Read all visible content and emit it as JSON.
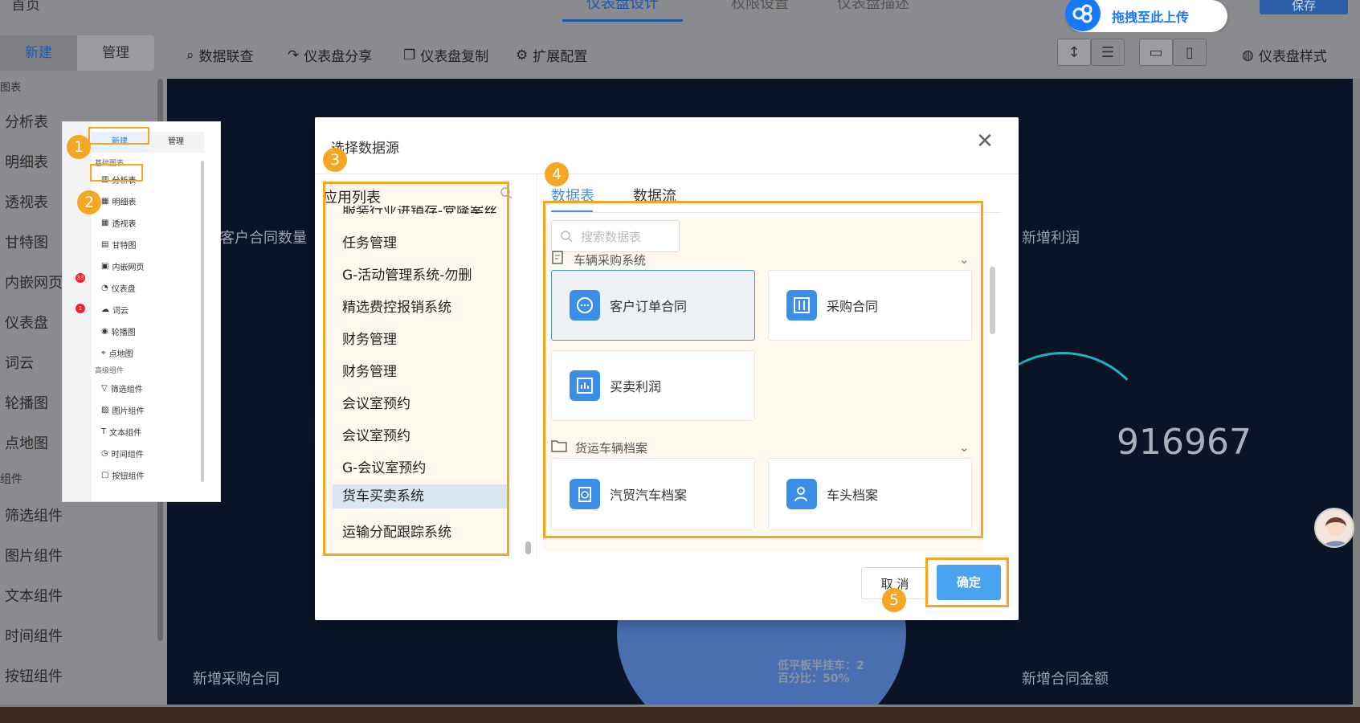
{
  "topbar": {
    "left_title": "首页",
    "tabs": [
      "仪表盘设计",
      "权限设置",
      "仪表盘描述"
    ],
    "upload_label": "拖拽至此上传",
    "save_label": "保存"
  },
  "sidebar": {
    "tabs": [
      "新建",
      "管理"
    ],
    "section_basic": "图表",
    "items_basic": [
      "分析表",
      "明细表",
      "透视表",
      "甘特图",
      "内嵌网页",
      "仪表盘",
      "词云",
      "轮播图",
      "点地图"
    ],
    "section_advanced": "组件",
    "items_advanced": [
      "筛选组件",
      "图片组件",
      "文本组件",
      "时间组件",
      "按钮组件"
    ]
  },
  "toolbar": {
    "items": [
      "数据联查",
      "仪表盘分享",
      "仪表盘复制",
      "扩展配置"
    ],
    "style_label": "仪表盘样式"
  },
  "canvas": {
    "labels": [
      "客户合同数量",
      "新增利润",
      "新增采购合同",
      "新增合同金额"
    ],
    "big_number": "916967",
    "annot_line1": "低平板半挂车：2",
    "annot_line2": "百分比：50%"
  },
  "inset": {
    "tabs": [
      "新建",
      "管理"
    ],
    "section_basic": "基础图表",
    "items_basic": [
      "分析表",
      "明细表",
      "透视表",
      "甘特图",
      "内嵌网页",
      "仪表盘",
      "词云",
      "轮播图",
      "点地图"
    ],
    "section_advanced": "高级组件",
    "items_advanced": [
      "筛选组件",
      "图片组件",
      "文本组件",
      "时间组件",
      "按钮组件"
    ],
    "badges": [
      "33",
      "1"
    ]
  },
  "steps": [
    "1",
    "2",
    "3",
    "4",
    "5"
  ],
  "modal": {
    "title": "选择数据源",
    "app_list_title": "应用列表",
    "apps": [
      "服装行业进销存-党隆案丝",
      "任务管理",
      "G-活动管理系统-勿删",
      "精选费控报销系统",
      "财务管理",
      "财务管理",
      "会议室预约",
      "会议室预约",
      "G-会议室预约",
      "货车买卖系统",
      "运输分配跟踪系统"
    ],
    "tabs": [
      "数据表",
      "数据流"
    ],
    "search_placeholder": "搜索数据表",
    "groups": [
      {
        "name": "车辆采购系统",
        "tables": [
          "客户订单合同",
          "采购合同",
          "买卖利润"
        ]
      },
      {
        "name": "货运车辆档案",
        "tables": [
          "汽贸汽车档案",
          "车头档案"
        ]
      }
    ],
    "cancel_label": "取 消",
    "ok_label": "确定"
  },
  "colors": {
    "accent": "#4a90e2",
    "highlight": "#f5a623",
    "icon_bg": "#3a8ee6"
  }
}
